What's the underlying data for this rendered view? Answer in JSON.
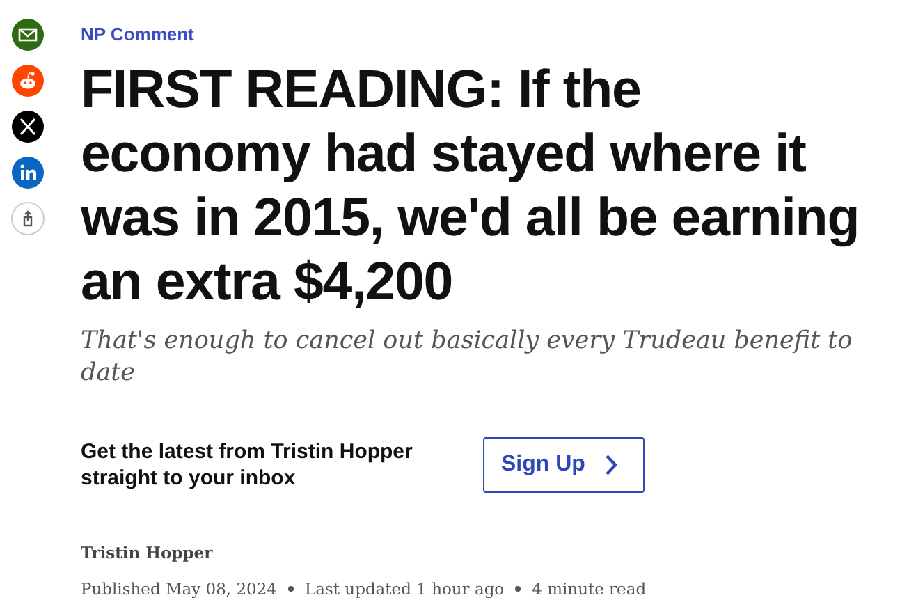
{
  "share": [
    {
      "kind": "email"
    },
    {
      "kind": "reddit"
    },
    {
      "kind": "x"
    },
    {
      "kind": "linkedin"
    },
    {
      "kind": "share"
    }
  ],
  "category": "NP Comment",
  "headline": "FIRST READING: If the economy had stayed where it was in 2015, we'd all be earning an extra $4,200",
  "subtitle": "That's enough to cancel out basically every Trudeau benefit to date",
  "newsletter": {
    "text": "Get the latest from Tristin Hopper straight to your inbox",
    "button": "Sign Up"
  },
  "author": "Tristin Hopper",
  "meta": [
    "Published May 08, 2024",
    "Last updated 1 hour ago",
    "4 minute read"
  ]
}
